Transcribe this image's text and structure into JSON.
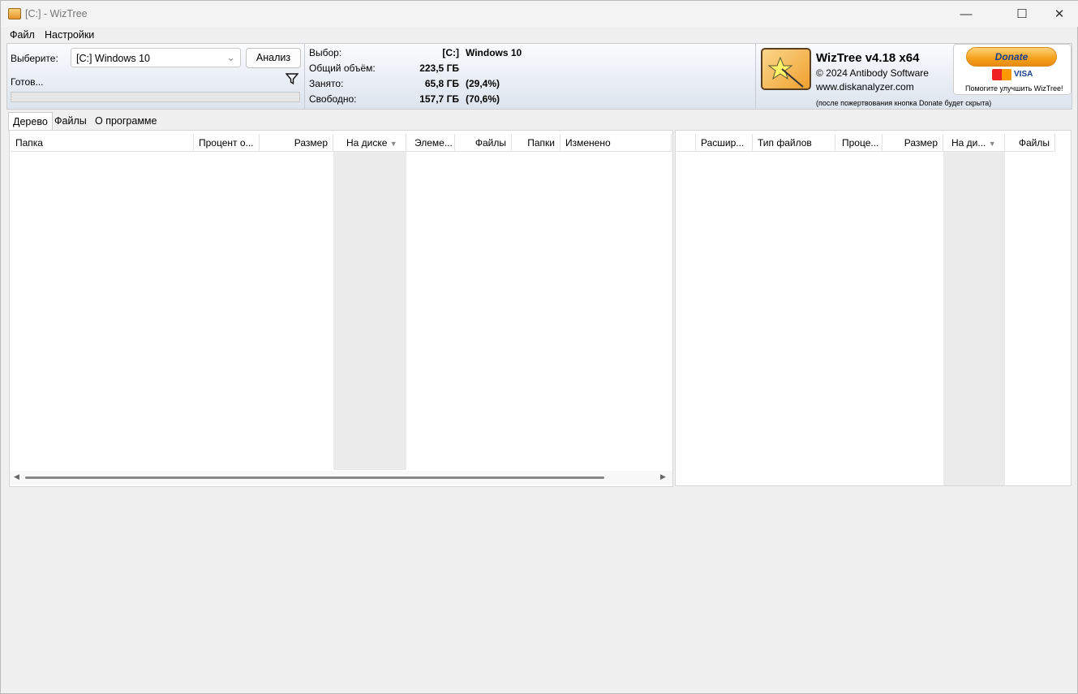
{
  "window": {
    "title": "[C:]  - WizTree",
    "minimize": "—",
    "maximize": "☐",
    "close": "✕"
  },
  "menu": [
    "Файл",
    "Настройки"
  ],
  "scan": {
    "select_label": "Выберите:",
    "drive_value": "[C:] Windows 10",
    "analyze_button": "Анализ",
    "status": "Готов...",
    "progress": 0
  },
  "drive_info": {
    "selection_label": "Выбор:",
    "selection_drive": "[C:]",
    "selection_name": "Windows 10",
    "total_label": "Общий объём:",
    "total_value": "223,5 ГБ",
    "used_label": "Занято:",
    "used_value": "65,8 ГБ",
    "used_pct": "(29,4%)",
    "free_label": "Свободно:",
    "free_value": "157,7 ГБ",
    "free_pct": "(70,6%)"
  },
  "about": {
    "title": "WizTree v4.18 x64",
    "copyright": "© 2024 Antibody Software",
    "url": "www.diskanalyzer.com",
    "note": "(после пожертвования кнопка Donate будет скрыта)"
  },
  "donate": {
    "button": "Donate",
    "cards": [
      "MasterCard",
      "VISA"
    ],
    "caption": "Помогите улучшить WizTree!"
  },
  "tabs": [
    "Дерево",
    "Файлы",
    "О программе"
  ],
  "tree_columns": [
    "Папка",
    "Процент о...",
    "Размер",
    "На диске",
    "Элеме...",
    "Файлы",
    "Папки",
    "Изменено"
  ],
  "ext_columns": [
    "",
    "Расшир...",
    "Тип файлов",
    "Проце...",
    "Размер",
    "На ди...",
    "Файлы"
  ],
  "sort_column": "На диске",
  "colors": {
    "header_gradient_end": "#dce4ee",
    "sorted_column_bg": "#ebebeb",
    "donate_orange": "#f5a01a"
  }
}
